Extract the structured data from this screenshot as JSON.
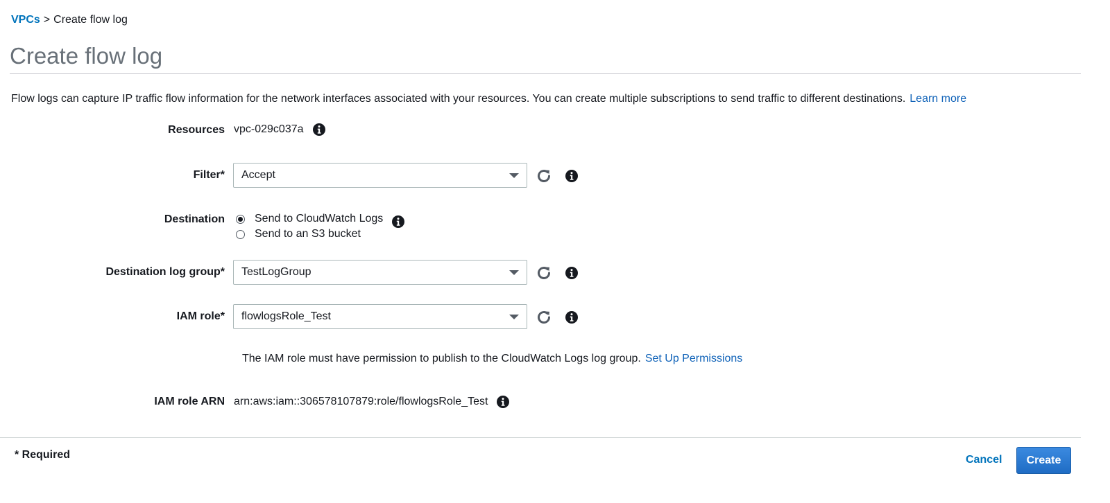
{
  "breadcrumb": {
    "parent": "VPCs",
    "separator": ">",
    "current": "Create flow log"
  },
  "page": {
    "title": "Create flow log",
    "description": "Flow logs can capture IP traffic flow information for the network interfaces associated with your resources. You can create multiple subscriptions to send traffic to different destinations.",
    "learn_more": "Learn more"
  },
  "form": {
    "resources": {
      "label": "Resources",
      "value": "vpc-029c037a"
    },
    "filter": {
      "label": "Filter*",
      "value": "Accept"
    },
    "destination": {
      "label": "Destination",
      "options": [
        {
          "label": "Send to CloudWatch Logs",
          "checked": true
        },
        {
          "label": "Send to an S3 bucket",
          "checked": false
        }
      ]
    },
    "log_group": {
      "label": "Destination log group*",
      "value": "TestLogGroup"
    },
    "iam_role": {
      "label": "IAM role*",
      "value": "flowlogsRole_Test"
    },
    "permission_note": "The IAM role must have permission to publish to the CloudWatch Logs log group.",
    "set_up_permissions": "Set Up Permissions",
    "iam_role_arn": {
      "label": "IAM role ARN",
      "value": "arn:aws:iam::306578107879:role/flowlogsRole_Test"
    }
  },
  "footer": {
    "required_note": "* Required",
    "cancel_label": "Cancel",
    "create_label": "Create"
  },
  "colors": {
    "link": "#0073bb",
    "primary_button": "#2c7bd1",
    "title": "#687078"
  },
  "icons": {
    "info": "info-icon",
    "refresh": "refresh-icon",
    "dropdown": "chevron-down-icon"
  }
}
